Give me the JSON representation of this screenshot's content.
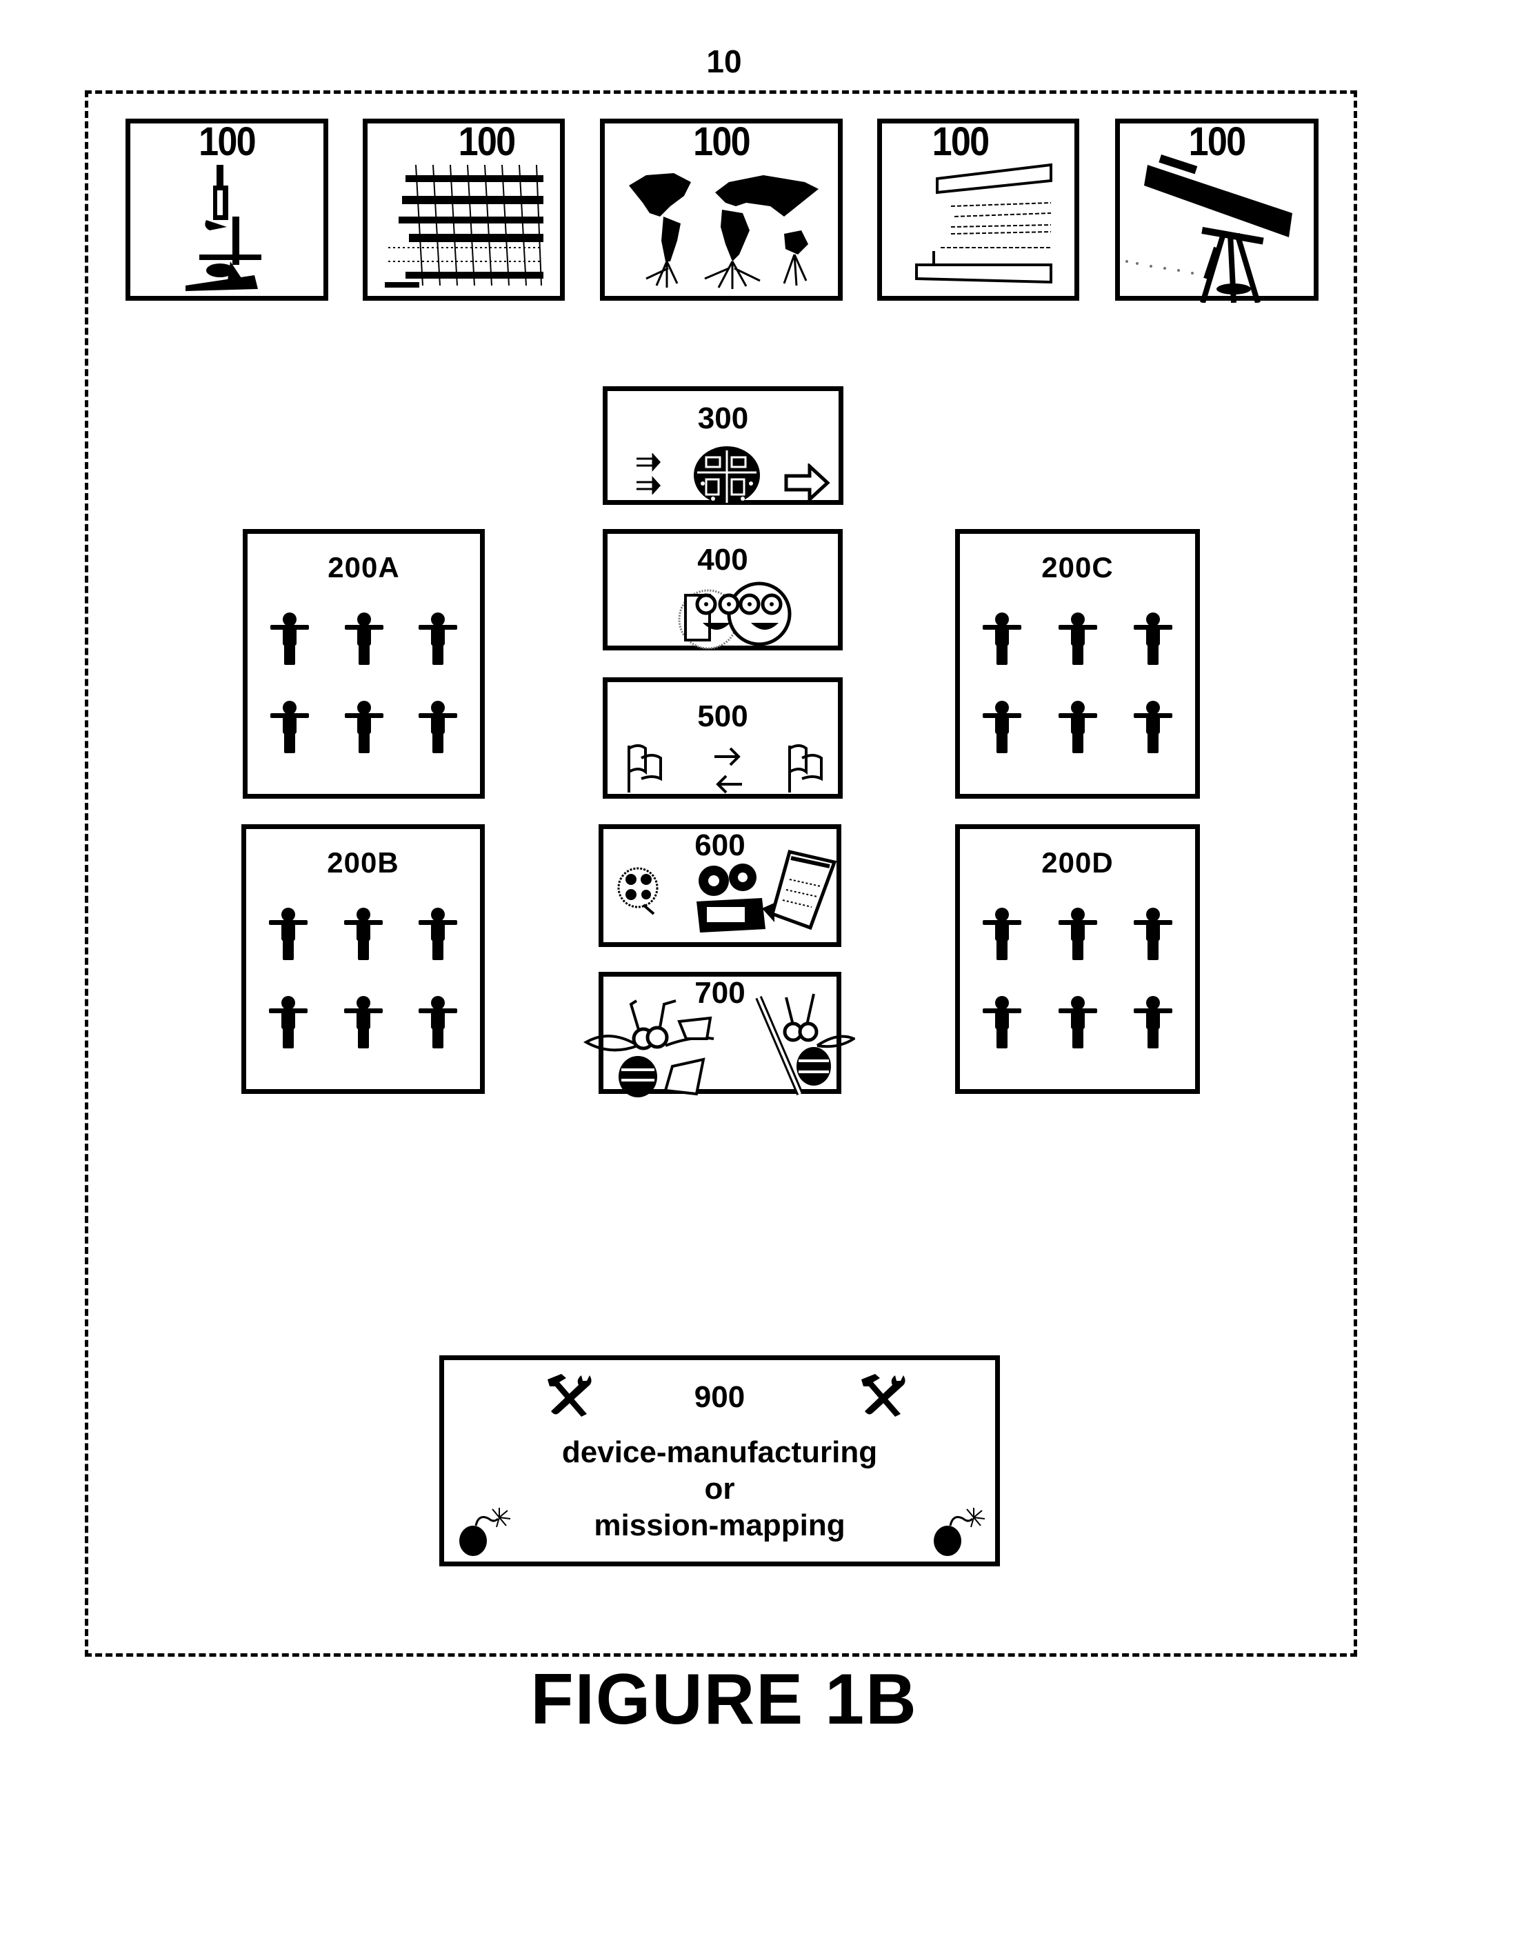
{
  "figure": {
    "reference_number": "10",
    "title": "FIGURE 1B"
  },
  "top_row": [
    {
      "label": "100",
      "icon": "microscope-icon"
    },
    {
      "label": "100",
      "icon": "dna-gel-sequence-icon"
    },
    {
      "label": "100",
      "icon": "world-map-roots-icon"
    },
    {
      "label": "100",
      "icon": "books-stack-icon"
    },
    {
      "label": "100",
      "icon": "telescope-icon"
    }
  ],
  "groups": {
    "a": {
      "label": "200A",
      "people_count": 6,
      "icon": "person-icon"
    },
    "b": {
      "label": "200B",
      "people_count": 6,
      "icon": "person-icon"
    },
    "c": {
      "label": "200C",
      "people_count": 6,
      "icon": "person-icon"
    },
    "d": {
      "label": "200D",
      "people_count": 6,
      "icon": "person-icon"
    }
  },
  "center_column": [
    {
      "label": "300",
      "icons": [
        "double-arrows-icon",
        "circuit-globe-icon",
        "outline-arrow-right-icon"
      ]
    },
    {
      "label": "400",
      "icons": [
        "faces-with-glasses-icon"
      ]
    },
    {
      "label": "500",
      "icons": [
        "flag-icon",
        "exchange-arrows-icon",
        "flag-icon"
      ]
    },
    {
      "label": "600",
      "icons": [
        "film-reel-icon",
        "movie-projector-icon",
        "notepad-icon"
      ]
    },
    {
      "label": "700",
      "icons": [
        "bee-with-papers-icon",
        "bee-with-pencil-icon"
      ]
    }
  ],
  "bottom_box": {
    "label": "900",
    "line1": "device-manufacturing",
    "line2": "or",
    "line3": "mission-mapping",
    "icons": [
      "hammer-wrench-icon",
      "hammer-wrench-icon",
      "bomb-icon",
      "bomb-icon"
    ]
  }
}
